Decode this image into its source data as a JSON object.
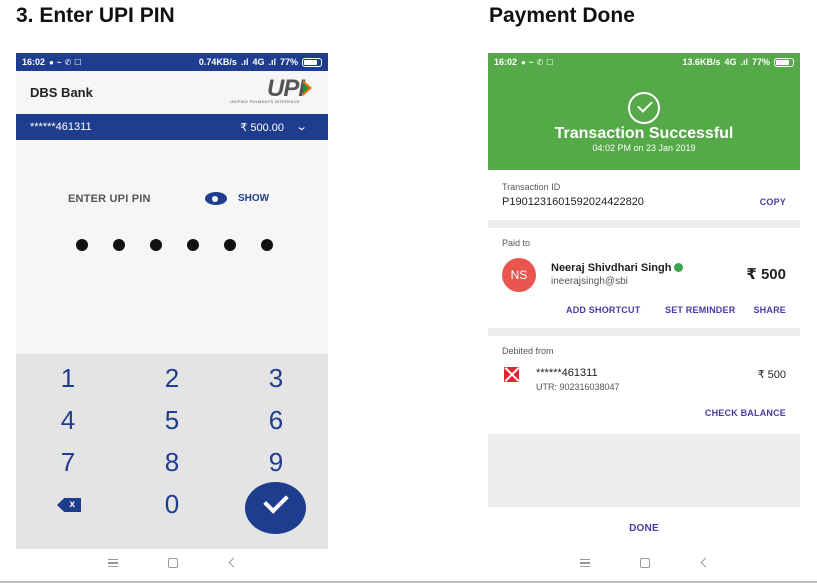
{
  "headings": {
    "left": "3. Enter UPI PIN",
    "right": "Payment Done"
  },
  "left_phone": {
    "status": {
      "time": "16:02",
      "speed": "0.74KB/s",
      "network": "4G",
      "battery": "77%"
    },
    "bank_name": "DBS Bank",
    "upi_logo": {
      "word": "UPI",
      "tagline": "UNIFIED PAYMENTS INTERFACE"
    },
    "account": {
      "number": "******461311",
      "amount": "₹ 500.00"
    },
    "pin": {
      "label": "ENTER UPI PIN",
      "show_label": "SHOW",
      "digits_entered": 6
    },
    "keypad": {
      "keys": [
        "1",
        "2",
        "3",
        "4",
        "5",
        "6",
        "7",
        "8",
        "9",
        "0"
      ]
    },
    "colors": {
      "primary": "#1f3d8f",
      "keypad_bg": "#e4e4e4"
    }
  },
  "right_phone": {
    "status": {
      "time": "16:02",
      "speed": "13.6KB/s",
      "network": "4G",
      "battery": "77%"
    },
    "success": {
      "title": "Transaction Successful",
      "time": "04:02 PM on 23 Jan 2019"
    },
    "transaction": {
      "label": "Transaction ID",
      "id": "P1901231601592024422820",
      "copy_label": "COPY"
    },
    "paid_to": {
      "label": "Paid to",
      "initials": "NS",
      "name": "Neeraj Shivdhari Singh",
      "vpa": "ineerajsingh@sbi",
      "amount": "₹ 500",
      "actions": {
        "shortcut": "ADD SHORTCUT",
        "reminder": "SET REMINDER",
        "share": "SHARE"
      }
    },
    "debited": {
      "label": "Debited from",
      "account": "******461311",
      "utr": "UTR: 902316038047",
      "amount": "₹ 500",
      "check_balance": "CHECK BALANCE"
    },
    "done_label": "DONE",
    "colors": {
      "success": "#55a948",
      "link": "#4a3aa8",
      "avatar": "#e8564f"
    }
  }
}
